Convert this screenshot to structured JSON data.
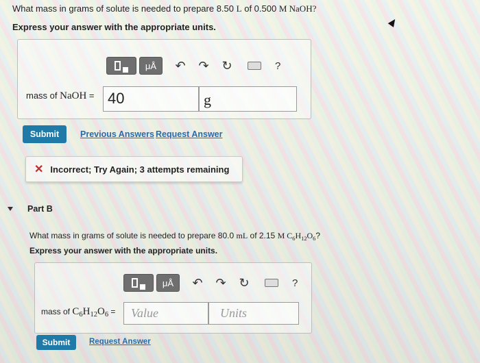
{
  "part_a": {
    "question_prefix": "What mass in grams of solute is needed to prepare 8.50",
    "question_unit_l": "L",
    "question_mid": "of 0.500",
    "question_molar": "M NaOH",
    "question_suffix": "?",
    "instruction": "Express your answer with the appropriate units.",
    "toolbar": {
      "mu_label": "μÅ",
      "help_label": "?"
    },
    "label_prefix": "mass of",
    "label_compound": "NaOH",
    "label_equals": "=",
    "value": "40",
    "unit": "g",
    "submit_label": "Submit",
    "previous_answers_label": "Previous Answers",
    "request_answer_label": "Request Answer",
    "feedback_icon": "✕",
    "feedback_text": "Incorrect; Try Again; 3 attempts remaining"
  },
  "part_b": {
    "title": "Part B",
    "question_prefix": "What mass in grams of solute is needed to prepare 80.0",
    "question_unit_ml": "mL",
    "question_mid": "of 2.15",
    "question_molar": "M C",
    "question_sub1": "6",
    "question_h": "H",
    "question_sub2": "12",
    "question_o": "O",
    "question_sub3": "6",
    "question_suffix": "?",
    "instruction": "Express your answer with the appropriate units.",
    "toolbar": {
      "mu_label": "μÅ",
      "help_label": "?"
    },
    "label_prefix": "mass of",
    "label_c": "C",
    "label_sub1": "6",
    "label_h": "H",
    "label_sub2": "12",
    "label_o": "O",
    "label_sub3": "6",
    "label_equals": "=",
    "value_placeholder": "Value",
    "units_placeholder": "Units",
    "submit_label": "Submit",
    "request_answer_label": "Request Answer"
  },
  "icons": {
    "undo": "↶",
    "redo": "↷",
    "reset": "↻"
  }
}
